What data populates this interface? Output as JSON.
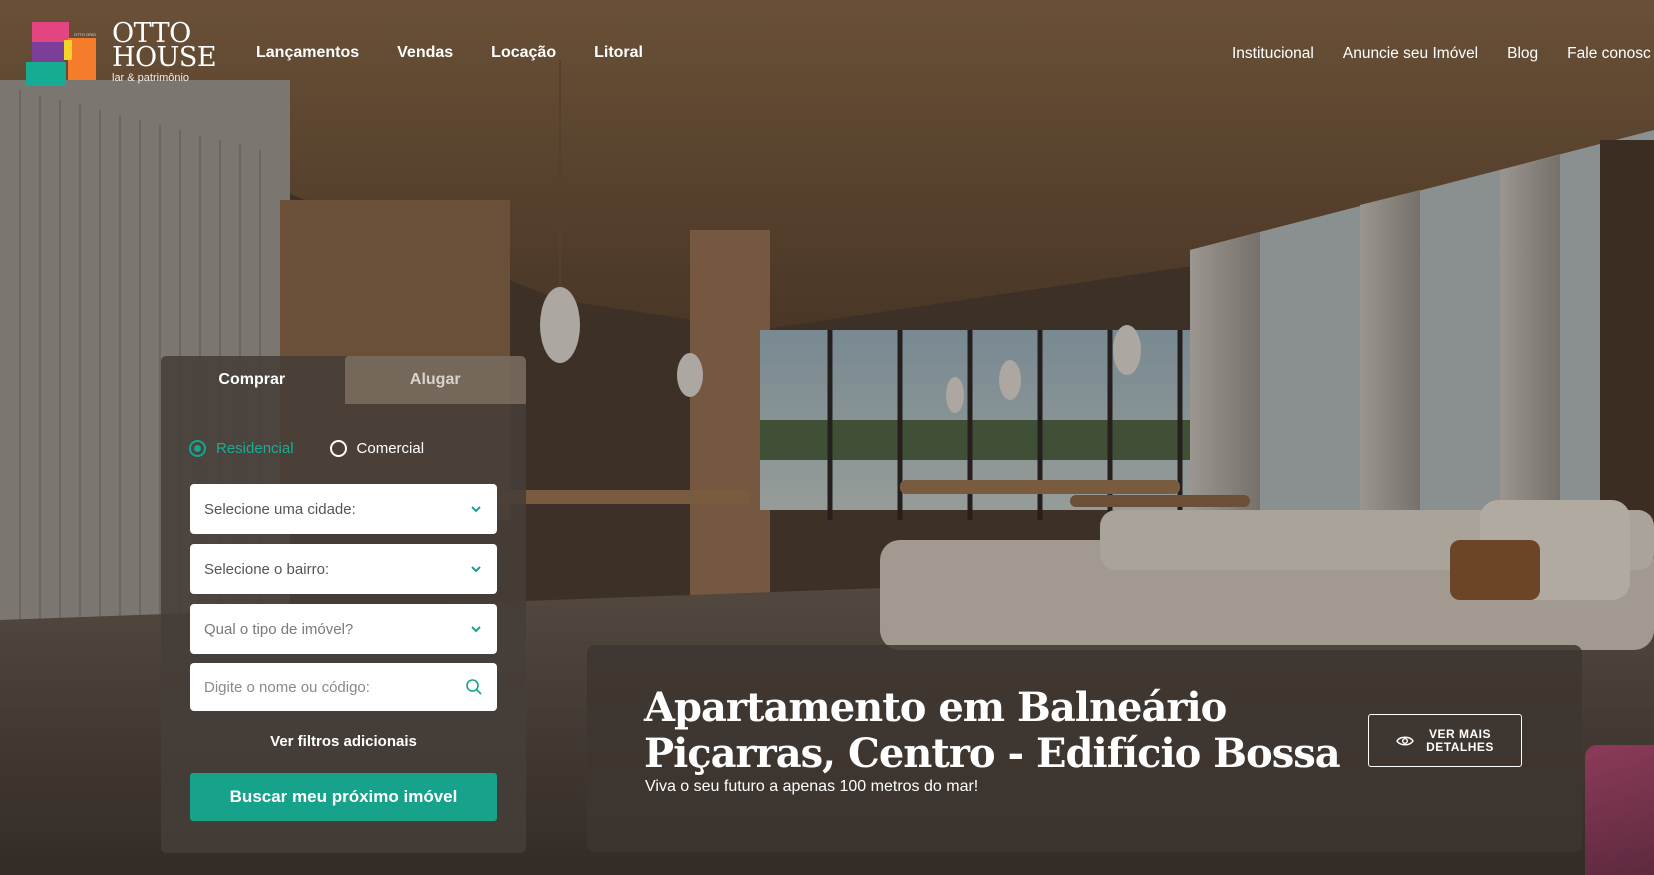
{
  "logo": {
    "line1": "OTTO",
    "line2": "HOUSE",
    "tagline": "lar & patrimônio",
    "mark_tiny": "OTTO GRID"
  },
  "nav_main": [
    "Lançamentos",
    "Vendas",
    "Locação",
    "Litoral"
  ],
  "nav_secondary": [
    "Institucional",
    "Anuncie seu Imóvel",
    "Blog",
    "Fale conosc"
  ],
  "search": {
    "tabs": [
      "Comprar",
      "Alugar"
    ],
    "active_tab": "Comprar",
    "radio_residencial": "Residencial",
    "radio_comercial": "Comercial",
    "selected_type": "Residencial",
    "city_placeholder": "Selecione uma cidade:",
    "neighborhood_placeholder": "Selecione o bairro:",
    "property_type_placeholder": "Qual o tipo de imóvel?",
    "code_placeholder": "Digite o nome ou código:",
    "more_filters": "Ver filtros adicionais",
    "submit": "Buscar meu próximo imóvel"
  },
  "feature": {
    "title": "Apartamento em Balneário Piçarras, Centro - Edifício Bossa",
    "subtitle": "Viva o seu futuro a apenas 100 metros do mar!",
    "cta_line1": "VER MAIS",
    "cta_line2": "DETALHES"
  },
  "colors": {
    "accent": "#16a28b",
    "card_bg": "#463e38",
    "logo_pink": "#e2457f",
    "logo_orange": "#f47c2a",
    "logo_teal": "#16ab93",
    "logo_purple": "#7b3f9a"
  },
  "icons": {
    "dropdown": "chevron-down-icon",
    "search": "search-icon",
    "details": "eye-icon"
  }
}
